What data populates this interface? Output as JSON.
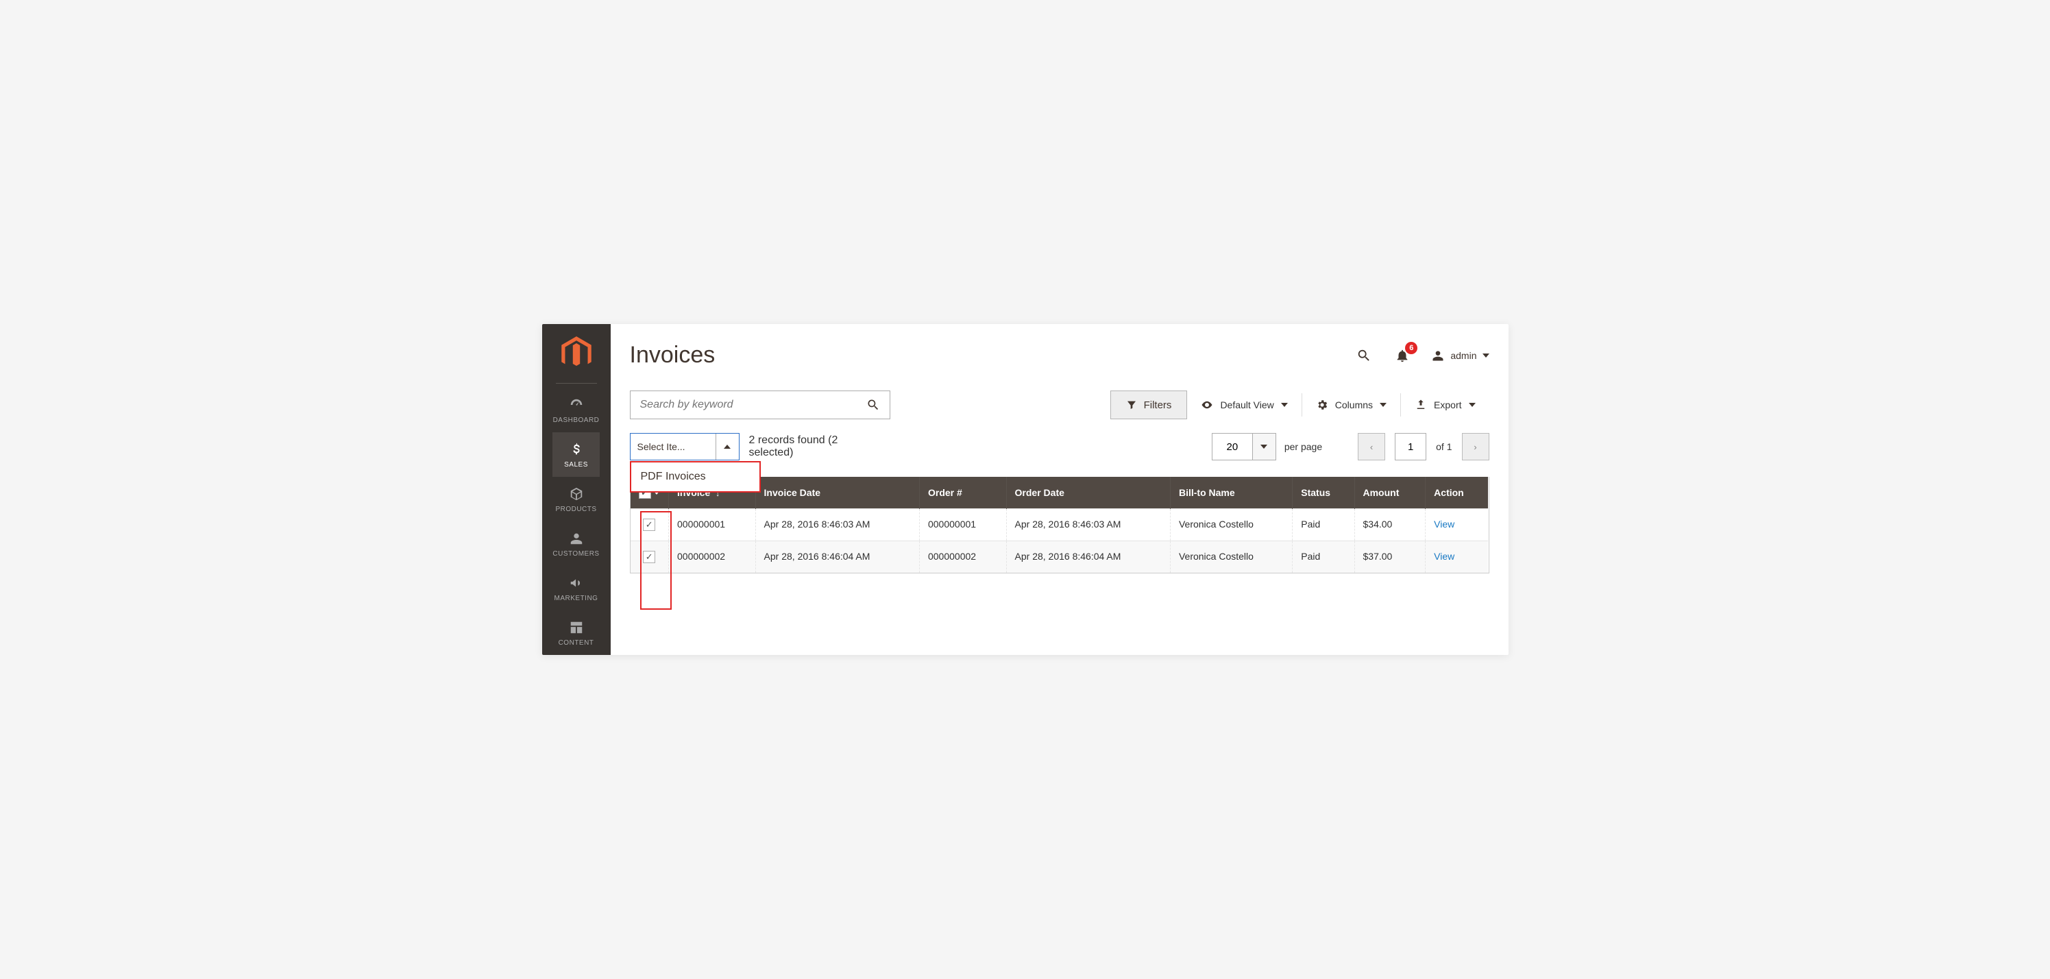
{
  "sidebar": {
    "items": [
      {
        "label": "DASHBOARD",
        "icon": "dashboard"
      },
      {
        "label": "SALES",
        "icon": "dollar"
      },
      {
        "label": "PRODUCTS",
        "icon": "box"
      },
      {
        "label": "CUSTOMERS",
        "icon": "person"
      },
      {
        "label": "MARKETING",
        "icon": "megaphone"
      },
      {
        "label": "CONTENT",
        "icon": "layout"
      }
    ],
    "active_index": 1
  },
  "header": {
    "title": "Invoices",
    "notifications_count": "6",
    "user_label": "admin"
  },
  "toolbar": {
    "search_placeholder": "Search by keyword",
    "filters_label": "Filters",
    "view_label": "Default View",
    "columns_label": "Columns",
    "export_label": "Export"
  },
  "mass_action": {
    "trigger_label": "Select Ite...",
    "option_label": "PDF Invoices"
  },
  "records_text": "2 records found (2 selected)",
  "pagination": {
    "page_size": "20",
    "per_page_label": "per page",
    "current_page": "1",
    "of_label": "of 1"
  },
  "columns": [
    "",
    "Invoice",
    "Invoice Date",
    "Order #",
    "Order Date",
    "Bill-to Name",
    "Status",
    "Amount",
    "Action"
  ],
  "sort_col_index": 1,
  "rows": [
    {
      "checked": true,
      "invoice": "000000001",
      "invoice_date": "Apr 28, 2016 8:46:03 AM",
      "order": "000000001",
      "order_date": "Apr 28, 2016 8:46:03 AM",
      "bill_to": "Veronica Costello",
      "status": "Paid",
      "amount": "$34.00",
      "action": "View"
    },
    {
      "checked": true,
      "invoice": "000000002",
      "invoice_date": "Apr 28, 2016 8:46:04 AM",
      "order": "000000002",
      "order_date": "Apr 28, 2016 8:46:04 AM",
      "bill_to": "Veronica Costello",
      "status": "Paid",
      "amount": "$37.00",
      "action": "View"
    }
  ]
}
